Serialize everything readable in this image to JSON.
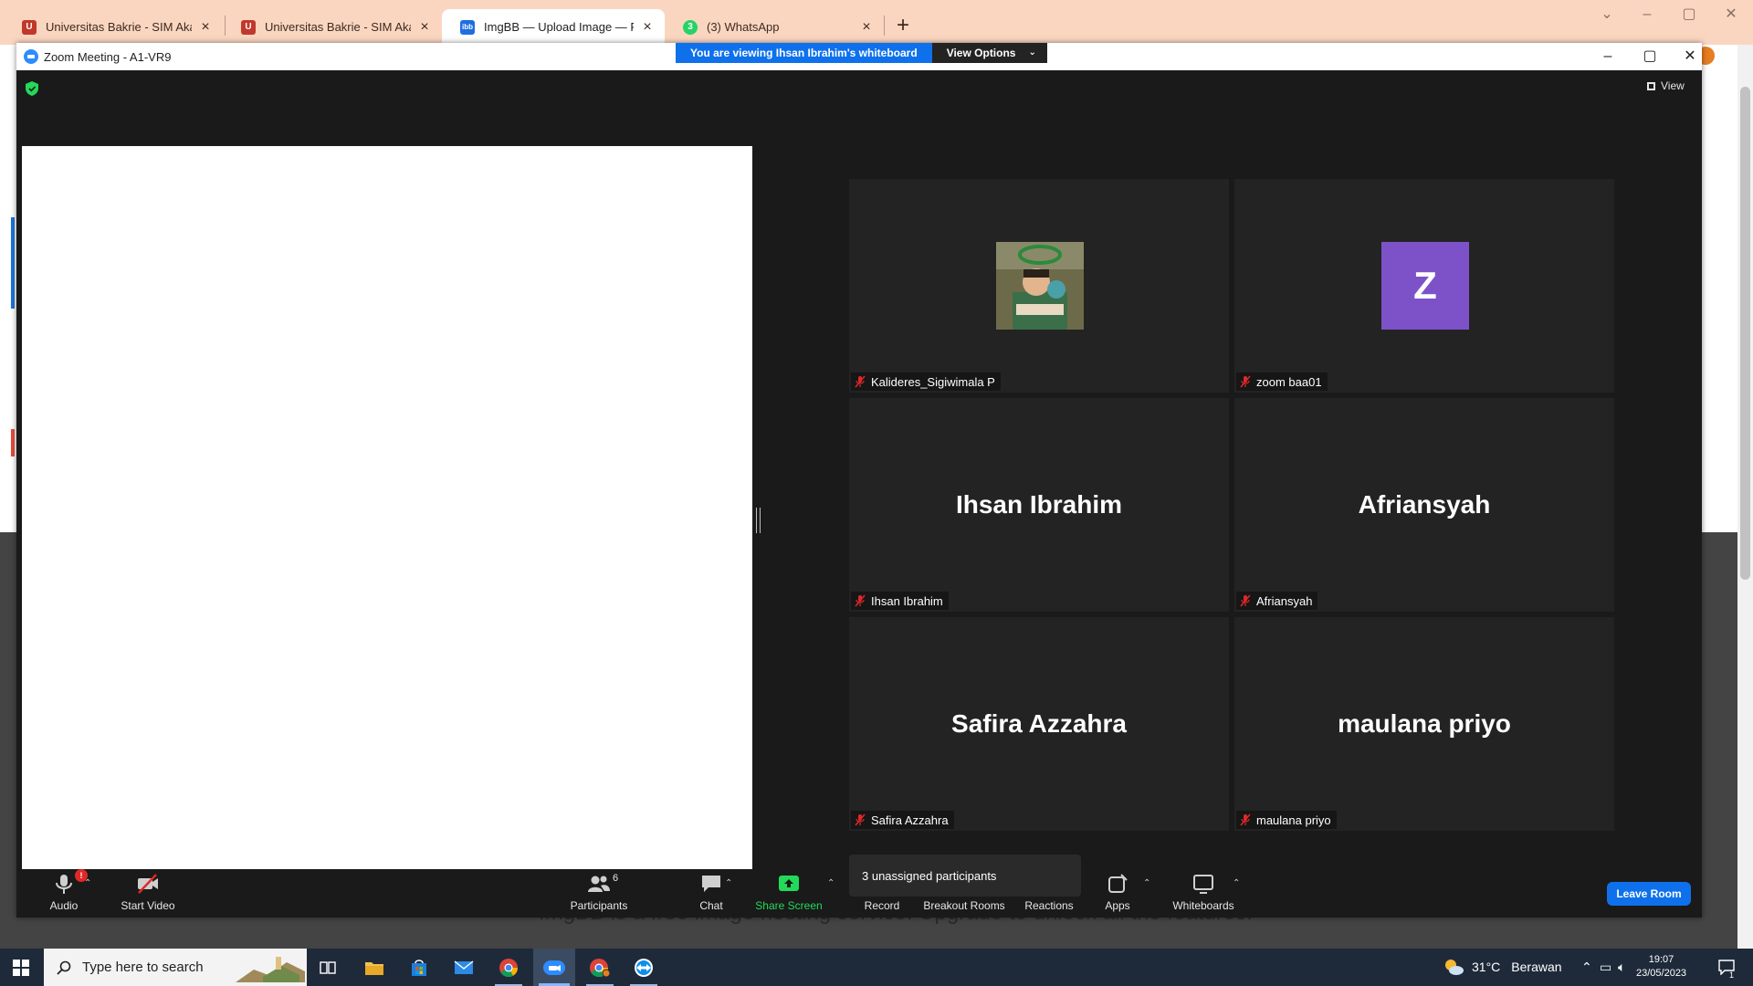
{
  "browser": {
    "tabs": [
      {
        "title": "Universitas Bakrie - SIM Akademik",
        "favicon": "U"
      },
      {
        "title": "Universitas Bakrie - SIM Akademik",
        "favicon": "U"
      },
      {
        "title": "ImgBB — Upload Image — Free Image Hosting",
        "favicon": "ibb"
      },
      {
        "title": "(3) WhatsApp",
        "favicon": "3"
      }
    ],
    "active_tab_index": 2,
    "background_page_text": "ImgBB is a free image hosting service. Upgrade to unlock all the features."
  },
  "zoom": {
    "window_title": "Zoom Meeting - A1-VR9",
    "banner": {
      "text": "You are viewing Ihsan Ibrahim's whiteboard",
      "options_label": "View Options"
    },
    "view_label": "View",
    "participants": [
      {
        "display": "",
        "name": "Kalideres_Sigiwimala P",
        "kind": "photo"
      },
      {
        "display": "Z",
        "name": "zoom baa01",
        "kind": "avatar"
      },
      {
        "display": "Ihsan Ibrahim",
        "name": "Ihsan Ibrahim",
        "kind": "text"
      },
      {
        "display": "Afriansyah",
        "name": "Afriansyah",
        "kind": "text"
      },
      {
        "display": "Safira Azzahra",
        "name": "Safira Azzahra",
        "kind": "text"
      },
      {
        "display": "maulana priyo",
        "name": "maulana priyo",
        "kind": "text"
      }
    ],
    "unassigned_popup": "3 unassigned participants",
    "toolbar": {
      "audio": "Audio",
      "audio_alert": "!",
      "start_video": "Start Video",
      "participants": "Participants",
      "participants_count": "6",
      "chat": "Chat",
      "share_screen": "Share Screen",
      "record": "Record",
      "breakout_rooms": "Breakout Rooms",
      "breakout_badge": "3",
      "reactions": "Reactions",
      "apps": "Apps",
      "whiteboards": "Whiteboards",
      "leave_room": "Leave Room"
    },
    "colors": {
      "accent": "#0e71eb",
      "share_green": "#23d959",
      "avatar_purple": "#7d52c8",
      "muted_red": "#e02828"
    }
  },
  "taskbar": {
    "search_placeholder": "Type here to search",
    "weather": {
      "temp": "31°C",
      "condition": "Berawan"
    },
    "time": "19:07",
    "date": "23/05/2023",
    "notification_count": "1",
    "pinned": [
      "task-view-icon",
      "file-explorer-icon",
      "store-icon",
      "mail-icon",
      "chrome-icon",
      "zoom-icon",
      "chrome-profile-icon",
      "teamviewer-icon"
    ]
  }
}
